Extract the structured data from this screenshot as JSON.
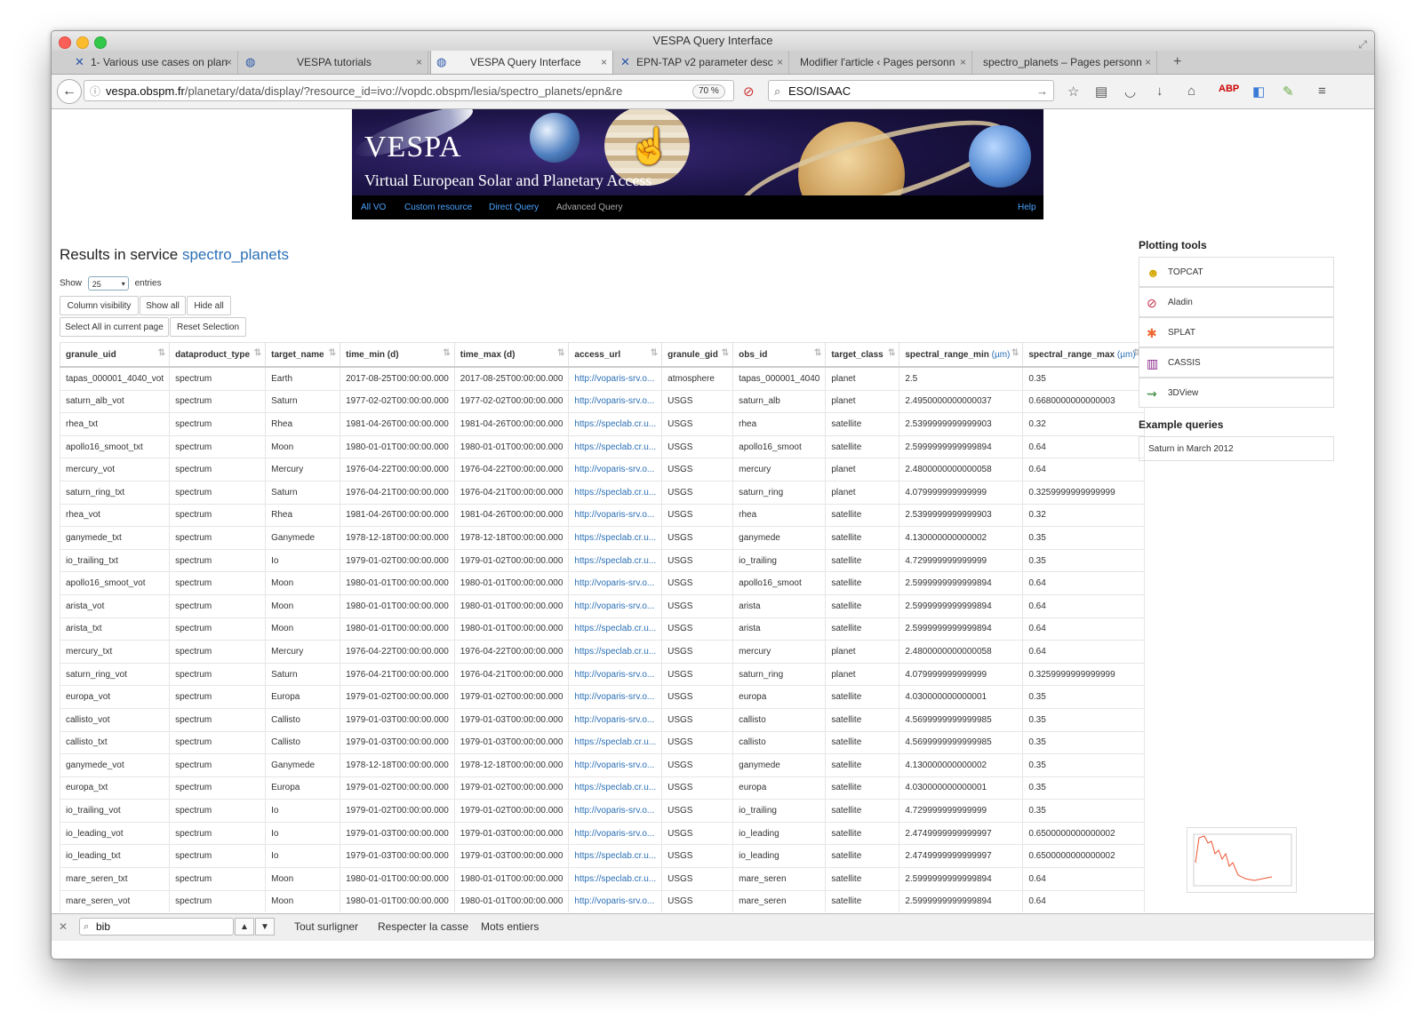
{
  "window": {
    "title": "VESPA Query Interface"
  },
  "tabs": [
    {
      "label": "1- Various use cases on plan",
      "icon": "x-logo-icon"
    },
    {
      "label": "VESPA tutorials",
      "icon": "globe-icon"
    },
    {
      "label": "VESPA Query Interface",
      "icon": "globe-icon"
    },
    {
      "label": "EPN-TAP v2 parameter desc",
      "icon": "x-logo-icon"
    },
    {
      "label": "Modifier l'article ‹ Pages personn",
      "icon": ""
    },
    {
      "label": "spectro_planets – Pages personn",
      "icon": ""
    }
  ],
  "url": {
    "domain": "vespa.obspm.fr",
    "path": "/planetary/data/display/?resource_id=ivo://vopdc.obspm/lesia/spectro_planets/epn&re",
    "zoom": "70 %"
  },
  "search": {
    "value": "ESO/ISAAC"
  },
  "banner": {
    "title": "VESPA",
    "subtitle": "Virtual European Solar and Planetary Access",
    "nav": [
      "All VO",
      "Custom resource",
      "Direct Query",
      "Advanced Query",
      "Help"
    ]
  },
  "results": {
    "title_prefix": "Results in service",
    "service": "spectro_planets",
    "show_label": "Show",
    "show_value": "25",
    "entries_label": "entries",
    "buttons": [
      "Column visibility",
      "Show all",
      "Hide all",
      "Select All in current page",
      "Reset Selection"
    ]
  },
  "table": {
    "columns": [
      {
        "label": "granule_uid",
        "unit": ""
      },
      {
        "label": "dataproduct_type",
        "unit": ""
      },
      {
        "label": "target_name",
        "unit": ""
      },
      {
        "label": "time_min (d)",
        "unit": ""
      },
      {
        "label": "time_max (d)",
        "unit": ""
      },
      {
        "label": "access_url",
        "unit": ""
      },
      {
        "label": "granule_gid",
        "unit": ""
      },
      {
        "label": "obs_id",
        "unit": ""
      },
      {
        "label": "target_class",
        "unit": ""
      },
      {
        "label": "spectral_range_min",
        "unit": "(µm)"
      },
      {
        "label": "spectral_range_max",
        "unit": "(µm)"
      }
    ],
    "rows": [
      [
        "tapas_000001_4040_vot",
        "spectrum",
        "Earth",
        "2017-08-25T00:00:00.000",
        "2017-08-25T00:00:00.000",
        "http://voparis-srv.o...",
        "atmosphere",
        "tapas_000001_4040",
        "planet",
        "2.5",
        "0.35"
      ],
      [
        "saturn_alb_vot",
        "spectrum",
        "Saturn",
        "1977-02-02T00:00:00.000",
        "1977-02-02T00:00:00.000",
        "http://voparis-srv.o...",
        "USGS",
        "saturn_alb",
        "planet",
        "2.4950000000000037",
        "0.6680000000000003"
      ],
      [
        "rhea_txt",
        "spectrum",
        "Rhea",
        "1981-04-26T00:00:00.000",
        "1981-04-26T00:00:00.000",
        "https://speclab.cr.u...",
        "USGS",
        "rhea",
        "satellite",
        "2.5399999999999903",
        "0.32"
      ],
      [
        "apollo16_smoot_txt",
        "spectrum",
        "Moon",
        "1980-01-01T00:00:00.000",
        "1980-01-01T00:00:00.000",
        "https://speclab.cr.u...",
        "USGS",
        "apollo16_smoot",
        "satellite",
        "2.5999999999999894",
        "0.64"
      ],
      [
        "mercury_vot",
        "spectrum",
        "Mercury",
        "1976-04-22T00:00:00.000",
        "1976-04-22T00:00:00.000",
        "http://voparis-srv.o...",
        "USGS",
        "mercury",
        "planet",
        "2.4800000000000058",
        "0.64"
      ],
      [
        "saturn_ring_txt",
        "spectrum",
        "Saturn",
        "1976-04-21T00:00:00.000",
        "1976-04-21T00:00:00.000",
        "https://speclab.cr.u...",
        "USGS",
        "saturn_ring",
        "planet",
        "4.079999999999999",
        "0.3259999999999999"
      ],
      [
        "rhea_vot",
        "spectrum",
        "Rhea",
        "1981-04-26T00:00:00.000",
        "1981-04-26T00:00:00.000",
        "http://voparis-srv.o...",
        "USGS",
        "rhea",
        "satellite",
        "2.5399999999999903",
        "0.32"
      ],
      [
        "ganymede_txt",
        "spectrum",
        "Ganymede",
        "1978-12-18T00:00:00.000",
        "1978-12-18T00:00:00.000",
        "https://speclab.cr.u...",
        "USGS",
        "ganymede",
        "satellite",
        "4.130000000000002",
        "0.35"
      ],
      [
        "io_trailing_txt",
        "spectrum",
        "Io",
        "1979-01-02T00:00:00.000",
        "1979-01-02T00:00:00.000",
        "https://speclab.cr.u...",
        "USGS",
        "io_trailing",
        "satellite",
        "4.729999999999999",
        "0.35"
      ],
      [
        "apollo16_smoot_vot",
        "spectrum",
        "Moon",
        "1980-01-01T00:00:00.000",
        "1980-01-01T00:00:00.000",
        "http://voparis-srv.o...",
        "USGS",
        "apollo16_smoot",
        "satellite",
        "2.5999999999999894",
        "0.64"
      ],
      [
        "arista_vot",
        "spectrum",
        "Moon",
        "1980-01-01T00:00:00.000",
        "1980-01-01T00:00:00.000",
        "http://voparis-srv.o...",
        "USGS",
        "arista",
        "satellite",
        "2.5999999999999894",
        "0.64"
      ],
      [
        "arista_txt",
        "spectrum",
        "Moon",
        "1980-01-01T00:00:00.000",
        "1980-01-01T00:00:00.000",
        "https://speclab.cr.u...",
        "USGS",
        "arista",
        "satellite",
        "2.5999999999999894",
        "0.64"
      ],
      [
        "mercury_txt",
        "spectrum",
        "Mercury",
        "1976-04-22T00:00:00.000",
        "1976-04-22T00:00:00.000",
        "https://speclab.cr.u...",
        "USGS",
        "mercury",
        "planet",
        "2.4800000000000058",
        "0.64"
      ],
      [
        "saturn_ring_vot",
        "spectrum",
        "Saturn",
        "1976-04-21T00:00:00.000",
        "1976-04-21T00:00:00.000",
        "http://voparis-srv.o...",
        "USGS",
        "saturn_ring",
        "planet",
        "4.079999999999999",
        "0.3259999999999999"
      ],
      [
        "europa_vot",
        "spectrum",
        "Europa",
        "1979-01-02T00:00:00.000",
        "1979-01-02T00:00:00.000",
        "http://voparis-srv.o...",
        "USGS",
        "europa",
        "satellite",
        "4.030000000000001",
        "0.35"
      ],
      [
        "callisto_vot",
        "spectrum",
        "Callisto",
        "1979-01-03T00:00:00.000",
        "1979-01-03T00:00:00.000",
        "http://voparis-srv.o...",
        "USGS",
        "callisto",
        "satellite",
        "4.5699999999999985",
        "0.35"
      ],
      [
        "callisto_txt",
        "spectrum",
        "Callisto",
        "1979-01-03T00:00:00.000",
        "1979-01-03T00:00:00.000",
        "https://speclab.cr.u...",
        "USGS",
        "callisto",
        "satellite",
        "4.5699999999999985",
        "0.35"
      ],
      [
        "ganymede_vot",
        "spectrum",
        "Ganymede",
        "1978-12-18T00:00:00.000",
        "1978-12-18T00:00:00.000",
        "http://voparis-srv.o...",
        "USGS",
        "ganymede",
        "satellite",
        "4.130000000000002",
        "0.35"
      ],
      [
        "europa_txt",
        "spectrum",
        "Europa",
        "1979-01-02T00:00:00.000",
        "1979-01-02T00:00:00.000",
        "https://speclab.cr.u...",
        "USGS",
        "europa",
        "satellite",
        "4.030000000000001",
        "0.35"
      ],
      [
        "io_trailing_vot",
        "spectrum",
        "Io",
        "1979-01-02T00:00:00.000",
        "1979-01-02T00:00:00.000",
        "http://voparis-srv.o...",
        "USGS",
        "io_trailing",
        "satellite",
        "4.729999999999999",
        "0.35"
      ],
      [
        "io_leading_vot",
        "spectrum",
        "Io",
        "1979-01-03T00:00:00.000",
        "1979-01-03T00:00:00.000",
        "http://voparis-srv.o...",
        "USGS",
        "io_leading",
        "satellite",
        "2.4749999999999997",
        "0.6500000000000002"
      ],
      [
        "io_leading_txt",
        "spectrum",
        "Io",
        "1979-01-03T00:00:00.000",
        "1979-01-03T00:00:00.000",
        "https://speclab.cr.u...",
        "USGS",
        "io_leading",
        "satellite",
        "2.4749999999999997",
        "0.6500000000000002"
      ],
      [
        "mare_seren_txt",
        "spectrum",
        "Moon",
        "1980-01-01T00:00:00.000",
        "1980-01-01T00:00:00.000",
        "https://speclab.cr.u...",
        "USGS",
        "mare_seren",
        "satellite",
        "2.5999999999999894",
        "0.64"
      ],
      [
        "mare_seren_vot",
        "spectrum",
        "Moon",
        "1980-01-01T00:00:00.000",
        "1980-01-01T00:00:00.000",
        "http://voparis-srv.o...",
        "USGS",
        "mare_seren",
        "satellite",
        "2.5999999999999894",
        "0.64"
      ]
    ]
  },
  "sidebar": {
    "plotting_title": "Plotting tools",
    "tools": [
      {
        "label": "TOPCAT",
        "icon": "topcat-icon"
      },
      {
        "label": "Aladin",
        "icon": "aladin-icon"
      },
      {
        "label": "SPLAT",
        "icon": "splat-icon"
      },
      {
        "label": "CASSIS",
        "icon": "cassis-icon"
      },
      {
        "label": "3DView",
        "icon": "3dview-icon"
      }
    ],
    "examples_title": "Example queries",
    "examples": [
      "Saturn in March 2012"
    ]
  },
  "findbar": {
    "value": "bib",
    "options": [
      "Tout surligner",
      "Respecter la casse",
      "Mots entiers"
    ]
  },
  "colors": {
    "link": "#2a6fb5",
    "banner_nav_link": "#4aa3ff"
  }
}
